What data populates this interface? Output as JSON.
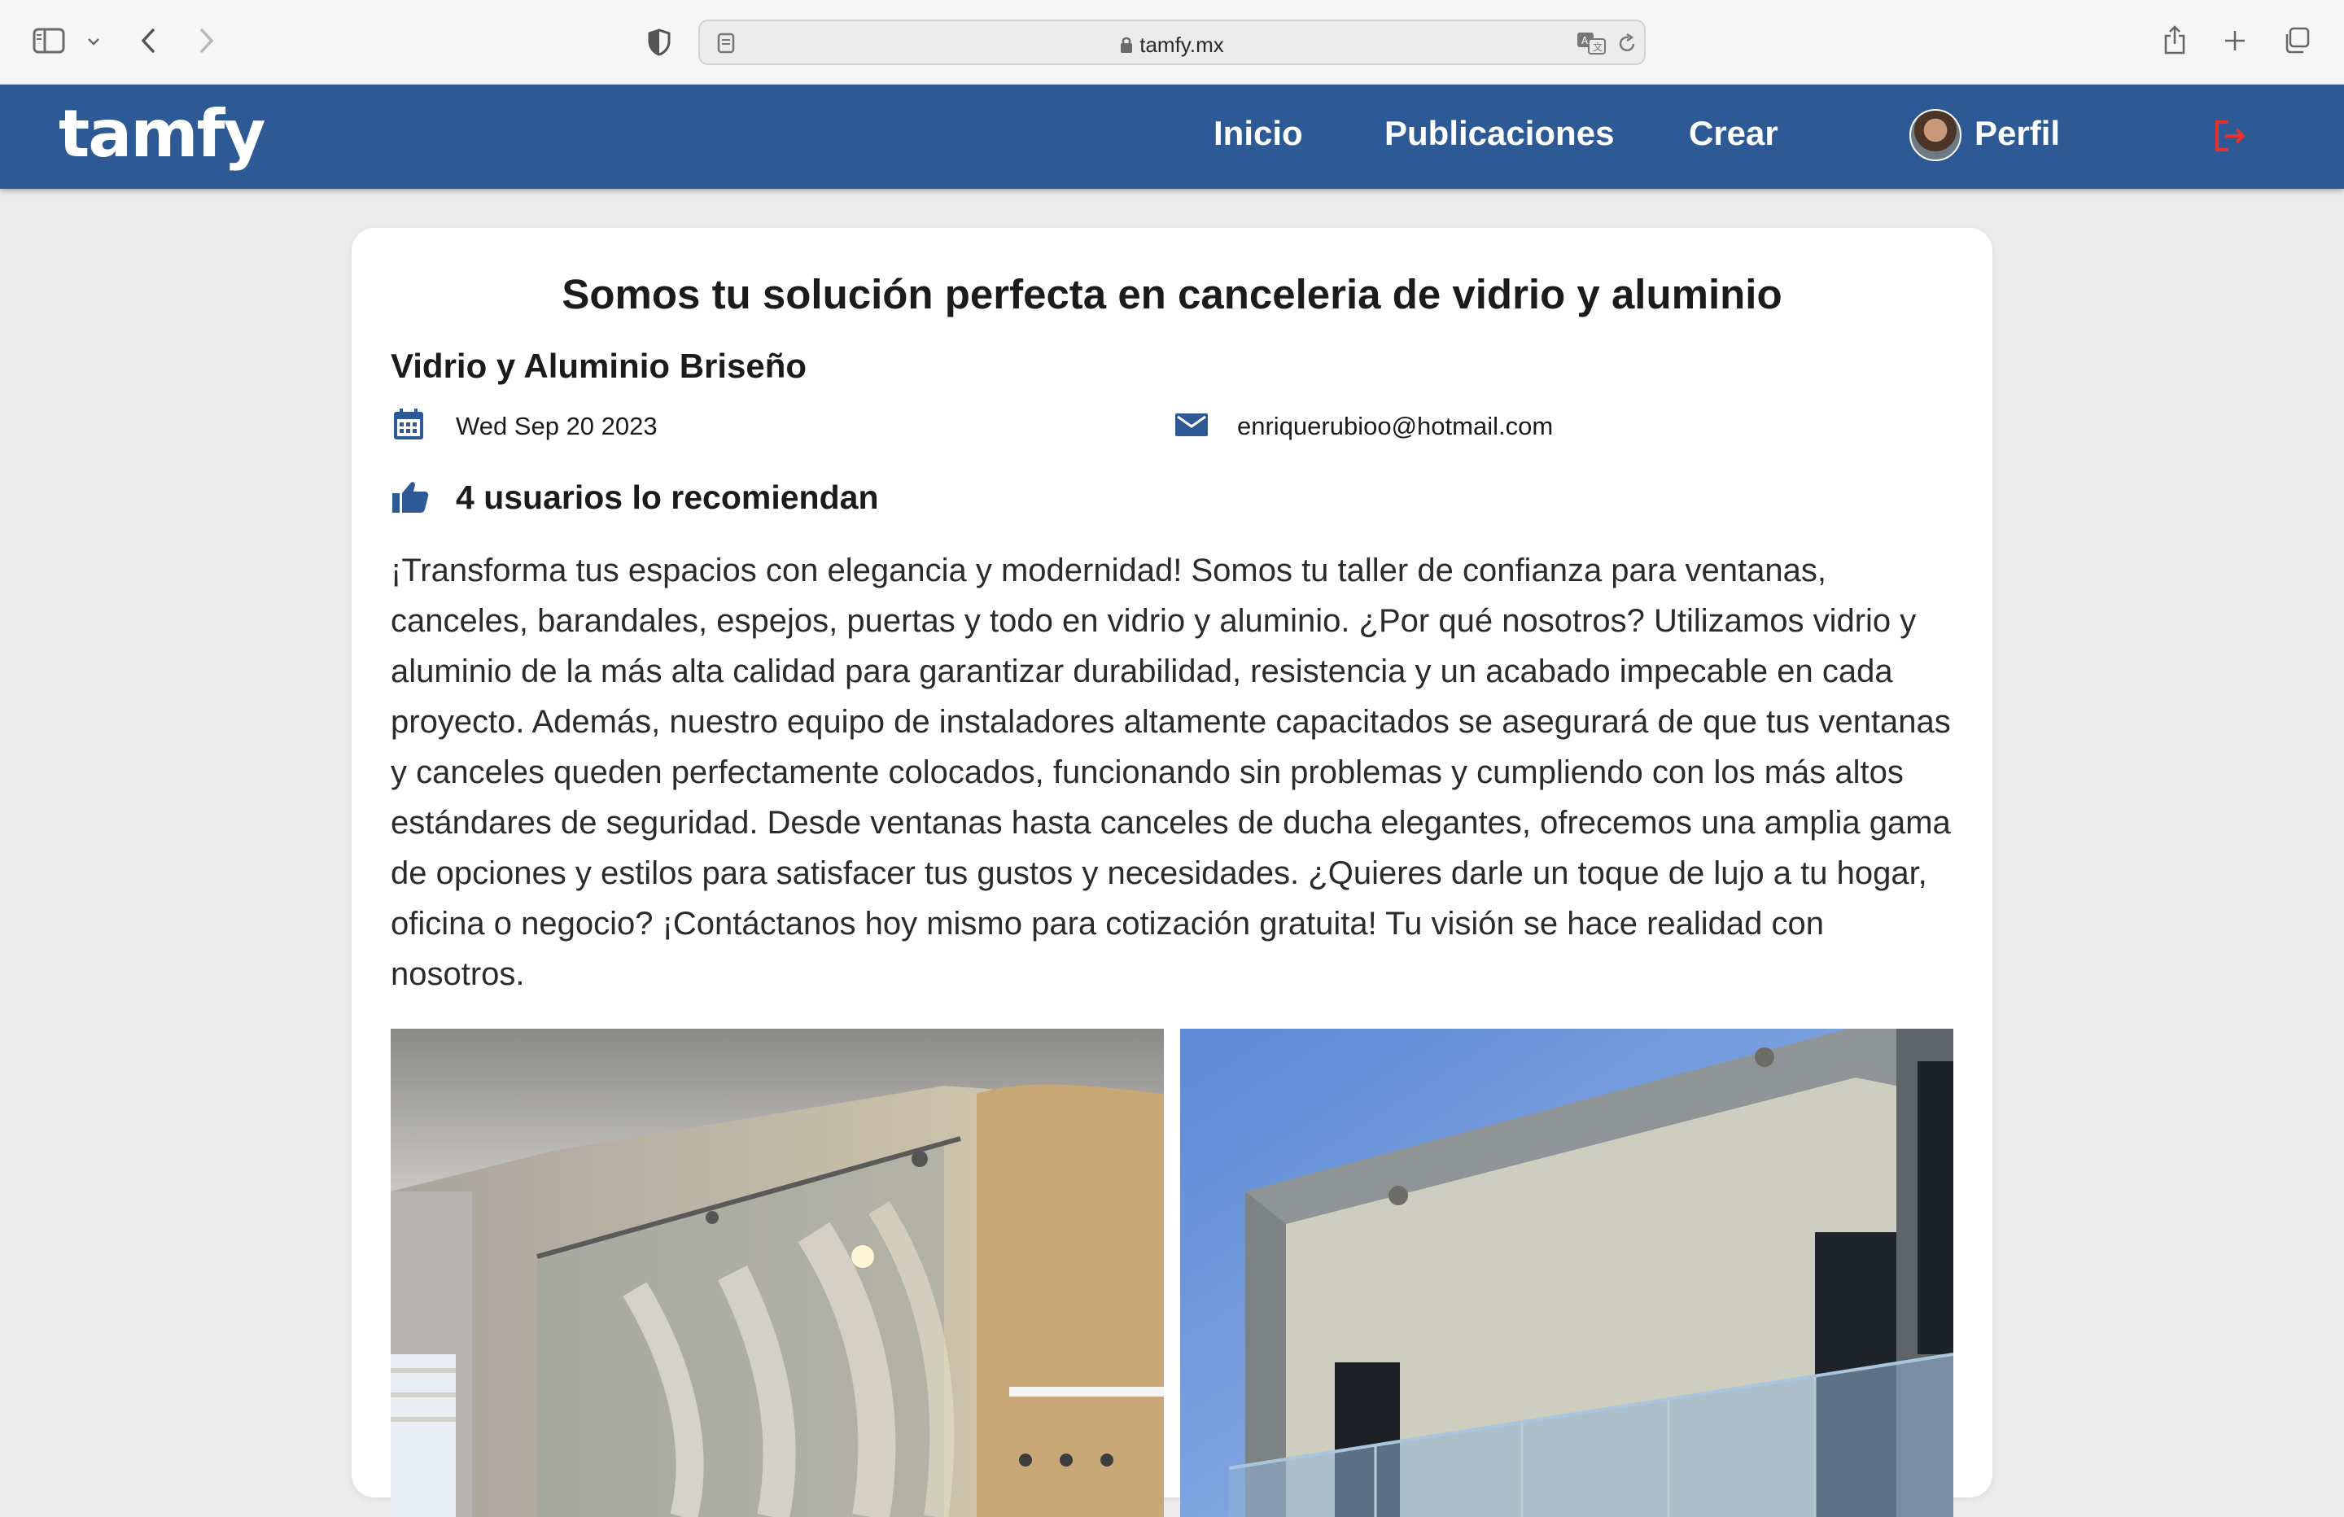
{
  "browser": {
    "url": "tamfy.mx"
  },
  "site": {
    "logo": "tamfy",
    "nav": {
      "home": "Inicio",
      "posts": "Publicaciones",
      "create": "Crear",
      "profile": "Perfil"
    }
  },
  "post": {
    "title": "Somos tu solución perfecta en canceleria de vidrio y aluminio",
    "business": "Vidrio y Aluminio Briseño",
    "date": "Wed Sep 20 2023",
    "email": "enriquerubioo@hotmail.com",
    "recommendations": "4 usuarios lo recomiendan",
    "description": "¡Transforma tus espacios con elegancia y modernidad! Somos tu taller de confianza para ventanas, canceles, barandales, espejos, puertas y todo en vidrio y aluminio. ¿Por qué nosotros? Utilizamos vidrio y aluminio de la más alta calidad para garantizar durabilidad, resistencia y un acabado impecable en cada proyecto. Además, nuestro equipo de instaladores altamente capacitados se asegurará de que tus ventanas y canceles queden perfectamente colocados, funcionando sin problemas y cumpliendo con los más altos estándares de seguridad. Desde ventanas hasta canceles de ducha elegantes, ofrecemos una amplia gama de opciones y estilos para satisfacer tus gustos y necesidades. ¿Quieres darle un toque de lujo a tu hogar, oficina o negocio? ¡Contáctanos hoy mismo para cotización gratuita! Tu visión se hace realidad con nosotros."
  },
  "colors": {
    "nav_bg": "#2d5a94",
    "icon_blue": "#2d5a94",
    "logout_red": "#e5322d"
  }
}
